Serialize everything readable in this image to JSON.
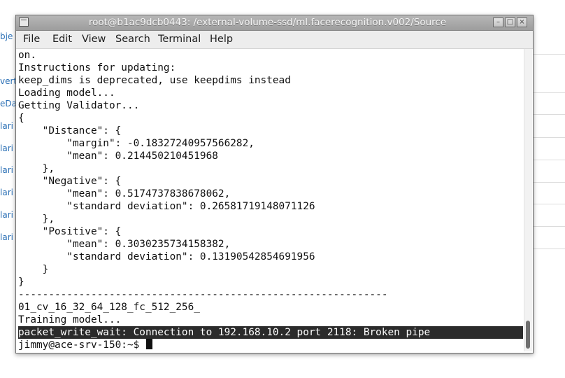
{
  "window": {
    "title": "root@b1ac9dcb0443: /external-volume-ssd/ml.facerecognition.v002/Source",
    "min_glyph": "–",
    "max_glyph": "□",
    "close_glyph": "×"
  },
  "menu": [
    "File",
    "Edit",
    "View",
    "Search",
    "Terminal",
    "Help"
  ],
  "terminal_lines": [
    "on.",
    "Instructions for updating:",
    "keep_dims is deprecated, use keepdims instead",
    "Loading model...",
    "Getting Validator...",
    "{",
    "    \"Distance\": {",
    "        \"margin\": -0.18327240957566282,",
    "        \"mean\": 0.214450210451968",
    "    },",
    "    \"Negative\": {",
    "        \"mean\": 0.5174737838678062,",
    "        \"standard deviation\": 0.26581719148071126",
    "    },",
    "    \"Positive\": {",
    "        \"mean\": 0.3030235734158382,",
    "        \"standard deviation\": 0.13190542854691956",
    "    }",
    "}",
    "-------------------------------------------------------------",
    "01_cv_16_32_64_128_fc_512_256_",
    "Training model...",
    "packet_write_wait: Connection to 192.168.10.2 port 2118: Broken pipe"
  ],
  "prompt": "jimmy@ace-srv-150:~$ ",
  "background_sidebar": [
    "bje",
    "vert",
    "eDa",
    "lari",
    "lari",
    "lari",
    "lari",
    "lari",
    "lari"
  ],
  "colors": {
    "titlebar": "#a9a9a9",
    "terminal_bg": "#ffffff",
    "terminal_fg": "#111111",
    "highlight_bg": "#2b2b2b",
    "link_blue": "#2a6fb5"
  }
}
